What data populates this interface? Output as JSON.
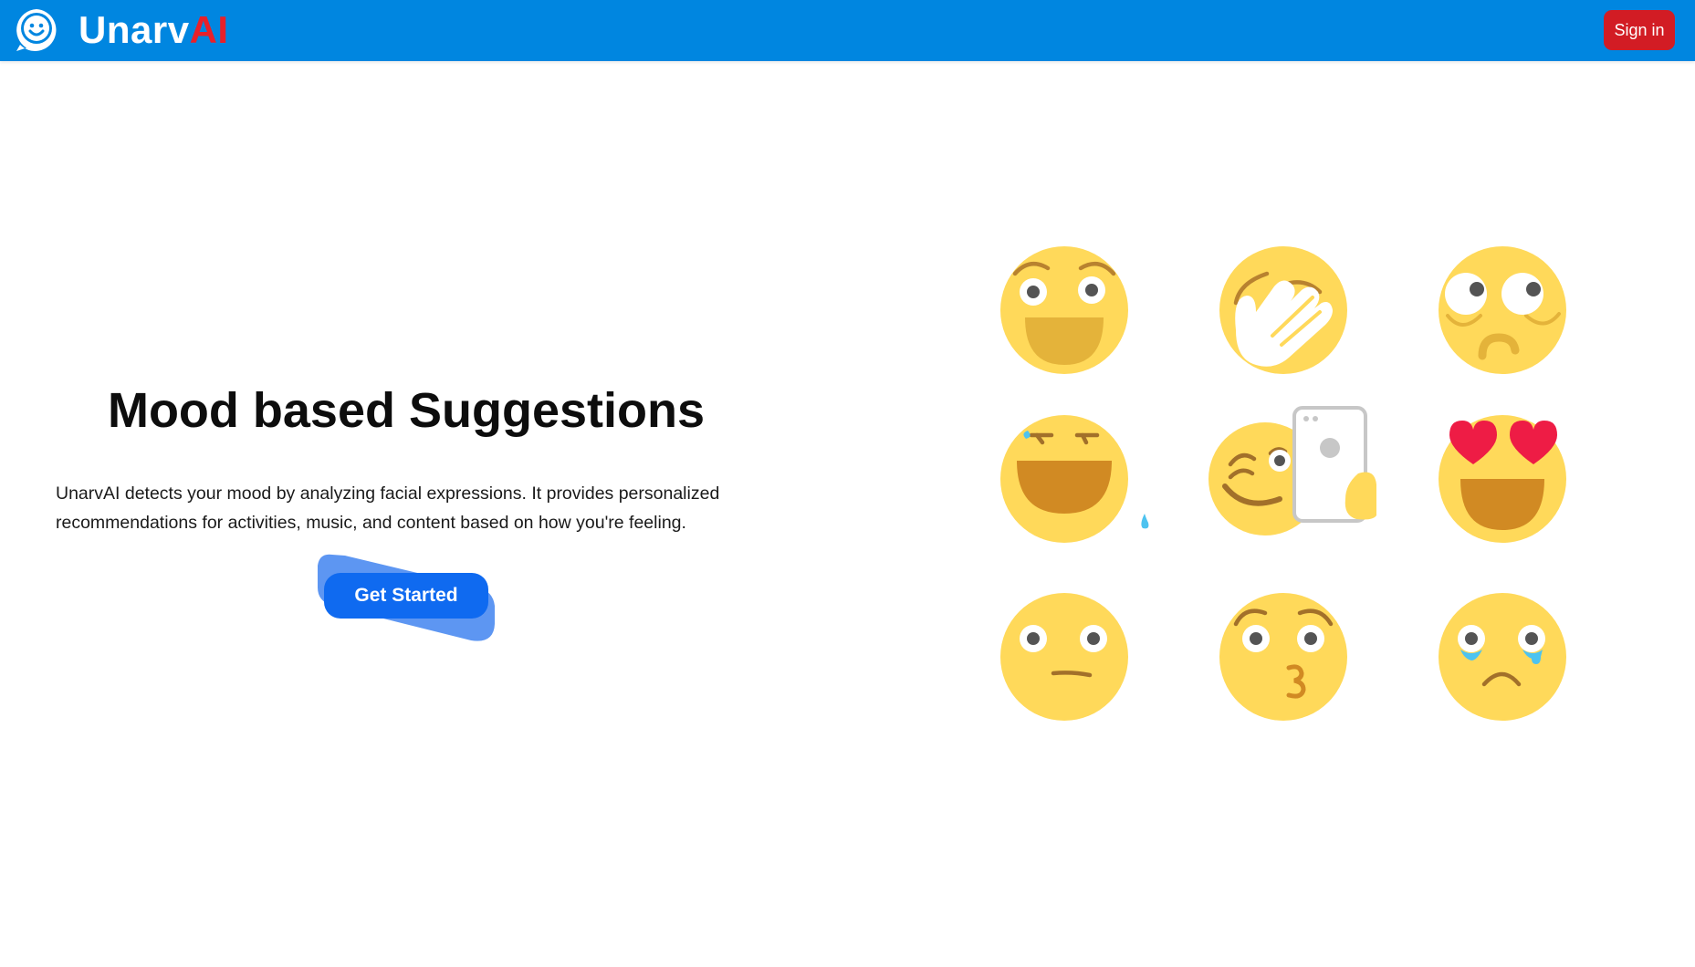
{
  "header": {
    "brand_name": "Unarv",
    "brand_accent": "AI",
    "signin_label": "Sign in"
  },
  "hero": {
    "title": "Mood based Suggestions",
    "description": "UnarvAI detects your mood by analyzing facial expressions. It provides personalized recommendations for activities, music, and content based on how you're feeling.",
    "cta_label": "Get Started"
  },
  "emojis": [
    "laughing-face",
    "facepalm-face",
    "eye-roll-face",
    "grinning-sweat-face",
    "winking-selfie-face",
    "heart-eyes-face",
    "neutral-face",
    "kissing-face",
    "crying-face"
  ],
  "colors": {
    "navbar": "#0086e0",
    "brand_accent": "#e8202a",
    "signin": "#d21c24",
    "cta": "#0f6af0",
    "emoji_face": "#ffd95a"
  }
}
